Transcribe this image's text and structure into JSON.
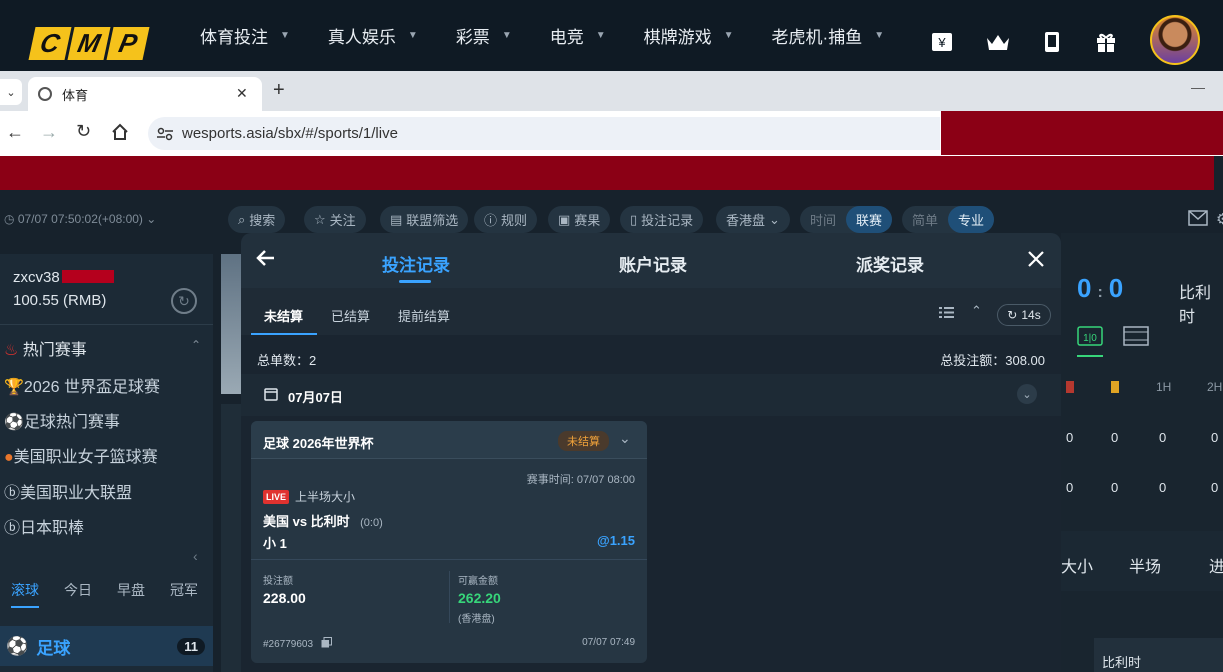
{
  "site": {
    "logo_letters": [
      "C",
      "M",
      "P"
    ],
    "nav": [
      {
        "label": "体育投注"
      },
      {
        "label": "真人娱乐"
      },
      {
        "label": "彩票"
      },
      {
        "label": "电竞"
      },
      {
        "label": "棋牌游戏"
      },
      {
        "label": "老虎机·捕鱼"
      }
    ]
  },
  "browser": {
    "tab_title": "体育",
    "tab_close": "✕",
    "new_tab": "+",
    "url": "wesports.asia/sbx/#/sports/1/live",
    "minimize": "—"
  },
  "toolbar": {
    "clock": "07/07 07:50:02(+08:00)",
    "buttons": [
      {
        "label": "搜索"
      },
      {
        "label": "关注"
      },
      {
        "label": "联盟筛选"
      },
      {
        "label": "规则"
      },
      {
        "label": "赛果"
      },
      {
        "label": "投注记录"
      }
    ],
    "odds_format": "香港盘",
    "toggle1": [
      "时间",
      "联赛"
    ],
    "toggle2": [
      "简单",
      "专业"
    ]
  },
  "account": {
    "username": "zxcv38",
    "balance": "100.55 (RMB)"
  },
  "sidebar": {
    "hot_title": "热门赛事",
    "items": [
      {
        "label": "2026 世界盃足球赛"
      },
      {
        "label": "足球热门赛事"
      },
      {
        "label": "美国职业女子篮球赛"
      },
      {
        "label": "美国职业大联盟"
      },
      {
        "label": "日本职棒"
      }
    ],
    "time_tabs": [
      "滚球",
      "今日",
      "早盘",
      "冠军"
    ],
    "sport": {
      "label": "足球",
      "count": "11"
    }
  },
  "modal": {
    "tabs": [
      "投注记录",
      "账户记录",
      "派奖记录"
    ],
    "subtabs": [
      "未结算",
      "已结算",
      "提前结算"
    ],
    "refresh": "14s",
    "total_count_label": "总单数：",
    "total_count": "2",
    "total_stake_label": "总投注额：",
    "total_stake": "308.00",
    "date": "07月07日",
    "bet": {
      "title": "足球 2026年世界杯",
      "status": "未结算",
      "match_time_label": "赛事时间:",
      "match_time": "07/07 08:00",
      "live_badge": "LIVE",
      "market": "上半场大小",
      "teams": "美国 vs 比利时",
      "score": "(0:0)",
      "selection": "小 1",
      "odds": "@1.15",
      "stake_label": "投注额",
      "stake": "228.00",
      "win_label": "可赢金额",
      "win": "262.20",
      "odds_type": "(香港盘)",
      "ticket": "#26779603",
      "placed": "07/07 07:49"
    }
  },
  "scoreboard": {
    "score_home": "0",
    "score_away": "0",
    "team": "比利时",
    "cols": [
      "1H",
      "2H"
    ],
    "rows": [
      [
        "0",
        "0",
        "0",
        "0"
      ],
      [
        "0",
        "0",
        "0",
        "0"
      ]
    ],
    "tabs": [
      "大小",
      "半场",
      "进"
    ],
    "bottom_team": "比利时"
  },
  "colors": {
    "accent": "#3aa3ff",
    "gold": "#f5c21b",
    "green": "#37d67a",
    "live": "#e0322f",
    "brand_red": "#8b0015"
  }
}
